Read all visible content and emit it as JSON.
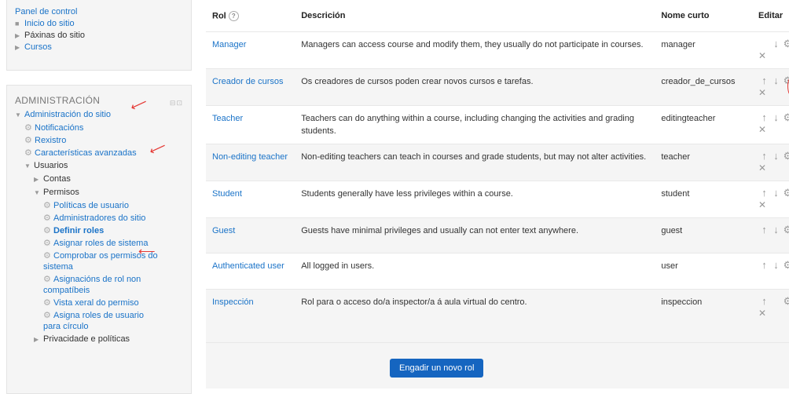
{
  "navigation": {
    "title": "Panel de control",
    "items": [
      {
        "label": "Inicio do sitio",
        "marker": "bullet",
        "link": true
      },
      {
        "label": "Páxinas do sitio",
        "marker": "triangle",
        "link": false
      },
      {
        "label": "Cursos",
        "marker": "triangle",
        "link": true
      }
    ]
  },
  "admin": {
    "heading": "ADMINISTRACIÓN",
    "collapse_icons": "⊟⊡",
    "tree": [
      {
        "label": "Administración do sitio",
        "indent": 0,
        "marker": "expanded",
        "link": true
      },
      {
        "label": "Notificacións",
        "indent": 1,
        "marker": "gear",
        "link": true
      },
      {
        "label": "Rexistro",
        "indent": 1,
        "marker": "gear",
        "link": true
      },
      {
        "label": "Características avanzadas",
        "indent": 1,
        "marker": "gear",
        "link": true
      },
      {
        "label": "Usuarios",
        "indent": 1,
        "marker": "expanded",
        "link": false
      },
      {
        "label": "Contas",
        "indent": 2,
        "marker": "collapsed",
        "link": false
      },
      {
        "label": "Permisos",
        "indent": 2,
        "marker": "expanded",
        "link": false
      },
      {
        "label": "Políticas de usuario",
        "indent": 3,
        "marker": "gear",
        "link": true
      },
      {
        "label": "Administradores do sitio",
        "indent": 3,
        "marker": "gear",
        "link": true
      },
      {
        "label": "Definir roles",
        "indent": 3,
        "marker": "gear",
        "link": true,
        "bold": true
      },
      {
        "label": "Asignar roles de sistema",
        "indent": 3,
        "marker": "gear",
        "link": true
      },
      {
        "label": "Comprobar os permisos do sistema",
        "indent": 3,
        "marker": "gear",
        "link": true
      },
      {
        "label": "Asignacións de rol non compatíbeis",
        "indent": 3,
        "marker": "gear",
        "link": true
      },
      {
        "label": "Vista xeral do permiso",
        "indent": 3,
        "marker": "gear",
        "link": true
      },
      {
        "label": "Asigna roles de usuario para círculo",
        "indent": 3,
        "marker": "gear",
        "link": true
      },
      {
        "label": "Privacidade e políticas",
        "indent": 2,
        "marker": "collapsed",
        "link": false
      }
    ]
  },
  "table": {
    "headers": {
      "role": "Rol",
      "description": "Descrición",
      "short_name": "Nome curto",
      "edit": "Editar"
    },
    "help_icon": "?",
    "rows": [
      {
        "role": "Manager",
        "description": "Managers can access course and modify them, they usually do not participate in courses.",
        "short_name": "manager",
        "up": false,
        "down": true,
        "delete": true
      },
      {
        "role": "Creador de cursos",
        "description": "Os creadores de cursos poden crear novos cursos e tarefas.",
        "short_name": "creador_de_cursos",
        "up": true,
        "down": true,
        "delete": true,
        "circled": true
      },
      {
        "role": "Teacher",
        "description": "Teachers can do anything within a course, including changing the activities and grading students.",
        "short_name": "editingteacher",
        "up": true,
        "down": true,
        "delete": true
      },
      {
        "role": "Non-editing teacher",
        "description": "Non-editing teachers can teach in courses and grade students, but may not alter activities.",
        "short_name": "teacher",
        "up": true,
        "down": true,
        "delete": true
      },
      {
        "role": "Student",
        "description": "Students generally have less privileges within a course.",
        "short_name": "student",
        "up": true,
        "down": true,
        "delete": true
      },
      {
        "role": "Guest",
        "description": "Guests have minimal privileges and usually can not enter text anywhere.",
        "short_name": "guest",
        "up": true,
        "down": true,
        "delete": false
      },
      {
        "role": "Authenticated user",
        "description": "All logged in users.",
        "short_name": "user",
        "up": true,
        "down": true,
        "delete": false
      },
      {
        "role": "Inspección",
        "description": "Rol para o acceso do/a inspector/a á aula virtual do centro.",
        "short_name": "inspeccion",
        "up": true,
        "down": false,
        "delete": true
      }
    ]
  },
  "add_role_button": "Engadir un novo rol",
  "colors": {
    "link": "#1a73c8",
    "button": "#1565c0",
    "annotation": "#e53935"
  }
}
